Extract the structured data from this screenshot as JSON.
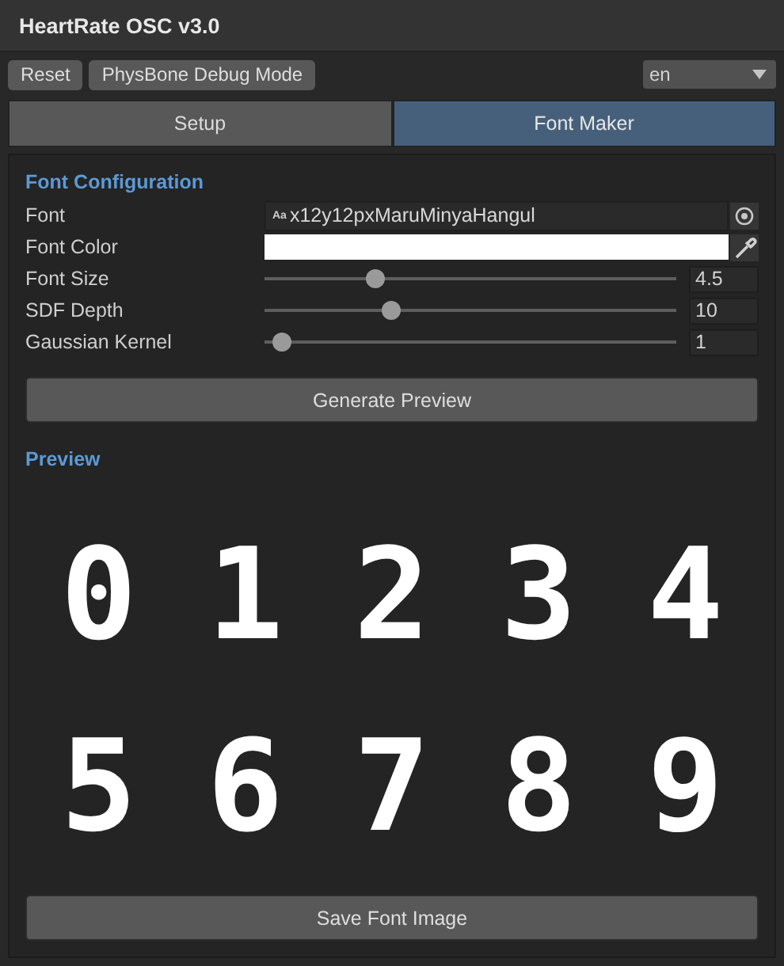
{
  "window": {
    "title": "HeartRate OSC v3.0"
  },
  "toolbar": {
    "buttons": [
      "Reset",
      "PhysBone Debug Mode"
    ],
    "language": "en"
  },
  "tabs": [
    {
      "label": "Setup",
      "selected": false
    },
    {
      "label": "Font Maker",
      "selected": true
    }
  ],
  "config": {
    "heading": "Font Configuration",
    "rows": [
      {
        "kind": "object",
        "label": "Font",
        "badge": "Aa",
        "value": "x12y12pxMaruMinyaHangul"
      },
      {
        "kind": "color",
        "label": "Font Color",
        "color": "#ffffff"
      },
      {
        "kind": "slider",
        "label": "Font Size",
        "level": 0.26,
        "value": "4.5"
      },
      {
        "kind": "slider",
        "label": "SDF Depth",
        "level": 0.3,
        "value": "10"
      },
      {
        "kind": "slider",
        "label": "Gaussian Kernel",
        "level": 0.02,
        "value": "1"
      }
    ]
  },
  "generate_button": "Generate Preview",
  "preview": {
    "heading": "Preview",
    "glyphs": [
      "0",
      "1",
      "2",
      "3",
      "4",
      "5",
      "6",
      "7",
      "8",
      "9"
    ]
  },
  "save_button": "Save Font Image"
}
